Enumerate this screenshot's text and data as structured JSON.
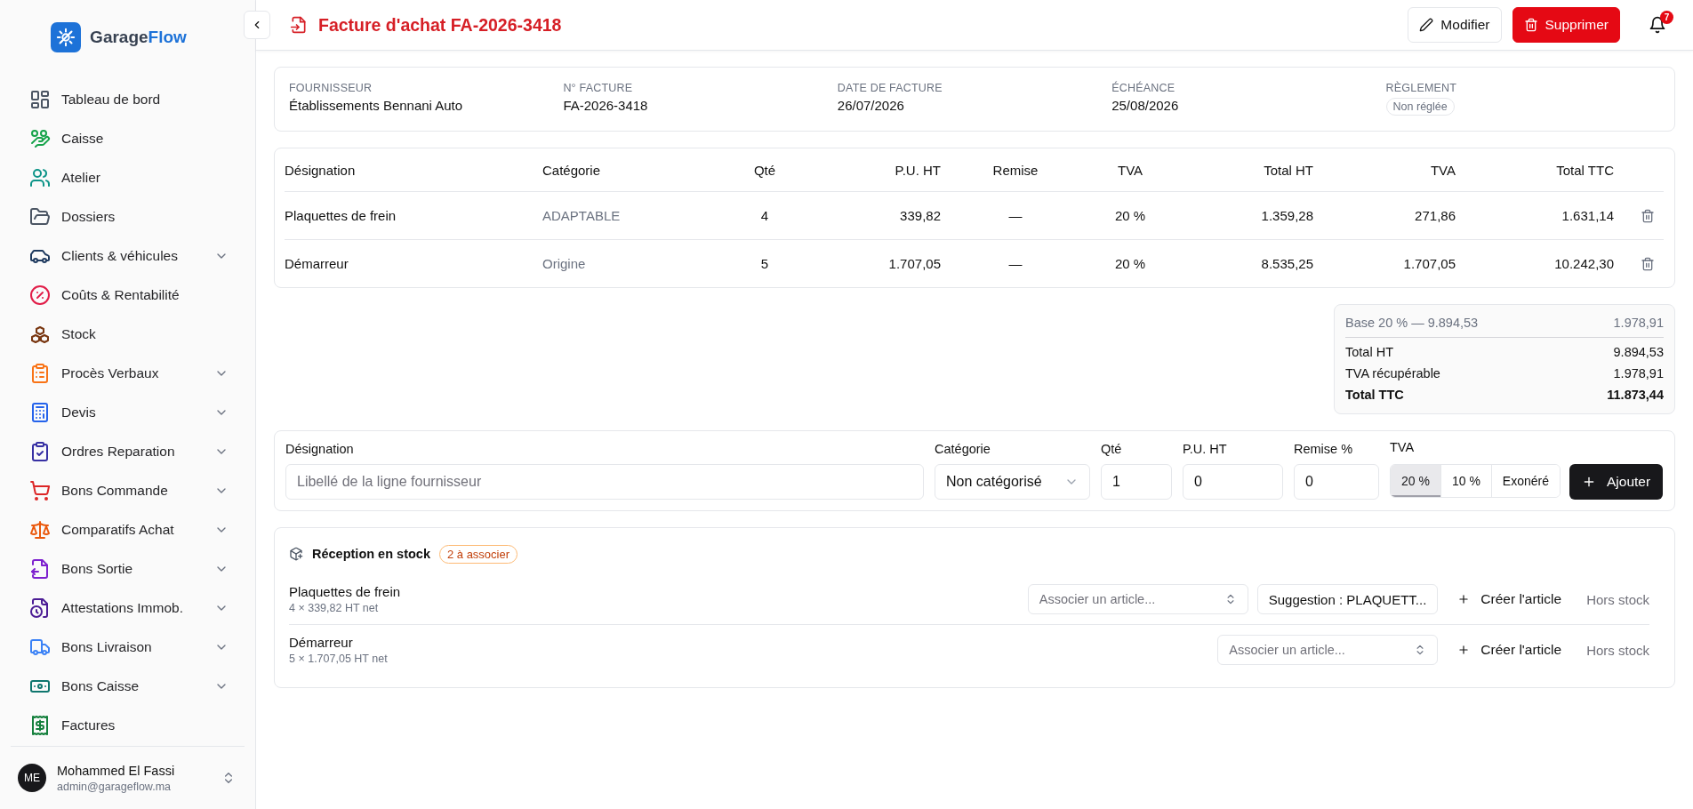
{
  "brand": {
    "text": "Garage",
    "accent": "Flow"
  },
  "sidebar": {
    "items": [
      {
        "label": "Tableau de bord",
        "color": "#4b5563",
        "expandable": false
      },
      {
        "label": "Caisse",
        "color": "#16a34a",
        "expandable": false
      },
      {
        "label": "Atelier",
        "color": "#0d9488",
        "expandable": false
      },
      {
        "label": "Dossiers",
        "color": "#4b5563",
        "expandable": false
      },
      {
        "label": "Clients & véhicules",
        "color": "#1e3a5f",
        "expandable": true
      },
      {
        "label": "Coûts & Rentabilité",
        "color": "#e11d48",
        "expandable": false
      },
      {
        "label": "Stock",
        "color": "#78350f",
        "expandable": false
      },
      {
        "label": "Procès Verbaux",
        "color": "#f97316",
        "expandable": true
      },
      {
        "label": "Devis",
        "color": "#2563eb",
        "expandable": true
      },
      {
        "label": "Ordres Reparation",
        "color": "#3730a3",
        "expandable": true
      },
      {
        "label": "Bons Commande",
        "color": "#dc2626",
        "expandable": true
      },
      {
        "label": "Comparatifs Achat",
        "color": "#ea580c",
        "expandable": true
      },
      {
        "label": "Bons Sortie",
        "color": "#7e22ce",
        "expandable": true
      },
      {
        "label": "Attestations Immob.",
        "color": "#4c1d95",
        "expandable": true
      },
      {
        "label": "Bons Livraison",
        "color": "#3b82f6",
        "expandable": true
      },
      {
        "label": "Bons Caisse",
        "color": "#0f766e",
        "expandable": true
      },
      {
        "label": "Factures",
        "color": "#15803d",
        "expandable": false
      }
    ]
  },
  "user": {
    "initials": "ME",
    "name": "Mohammed El Fassi",
    "email": "admin@garageflow.ma"
  },
  "header": {
    "title": "Facture d'achat FA-2026-3418",
    "edit_button": "Modifier",
    "delete_button": "Supprimer",
    "notifications": "7"
  },
  "info": [
    {
      "label": "FOURNISSEUR",
      "value": "Établissements Bennani Auto",
      "kind": "text"
    },
    {
      "label": "N° FACTURE",
      "value": "FA-2026-3418",
      "kind": "text"
    },
    {
      "label": "DATE DE FACTURE",
      "value": "26/07/2026",
      "kind": "text"
    },
    {
      "label": "ÉCHÉANCE",
      "value": "25/08/2026",
      "kind": "text"
    },
    {
      "label": "RÈGLEMENT",
      "value": "Non réglée",
      "kind": "badge"
    }
  ],
  "table": {
    "columns": [
      "Désignation",
      "Catégorie",
      "Qté",
      "P.U. HT",
      "Remise",
      "TVA",
      "Total HT",
      "TVA",
      "Total TTC"
    ],
    "rows": [
      {
        "cells": [
          "Plaquettes de frein",
          "ADAPTABLE",
          "4",
          "339,82",
          "—",
          "20 %",
          "1.359,28",
          "271,86",
          "1.631,14"
        ]
      },
      {
        "cells": [
          "Démarreur",
          "Origine",
          "5",
          "1.707,05",
          "—",
          "20 %",
          "8.535,25",
          "1.707,05",
          "10.242,30"
        ]
      }
    ]
  },
  "totals": {
    "base": {
      "label": "Base 20 % — 9.894,53",
      "value": "1.978,91"
    },
    "rows": [
      {
        "label": "Total HT",
        "value": "9.894,53",
        "emphasis": false
      },
      {
        "label": "TVA récupérable",
        "value": "1.978,91",
        "emphasis": false
      },
      {
        "label": "Total TTC",
        "value": "11.873,44",
        "emphasis": true
      }
    ]
  },
  "line_form": {
    "designation": {
      "label": "Désignation",
      "placeholder": "Libellé de la ligne fournisseur"
    },
    "category": {
      "label": "Catégorie",
      "value": "Non catégorisé"
    },
    "quantity": {
      "label": "Qté",
      "value": "1"
    },
    "unit_price": {
      "label": "P.U. HT",
      "value": "0"
    },
    "discount": {
      "label": "Remise %",
      "value": "0"
    },
    "vat": {
      "label": "TVA",
      "options": [
        {
          "label": "20 %",
          "selected": true
        },
        {
          "label": "10 %",
          "selected": false
        },
        {
          "label": "Exonéré",
          "selected": false
        }
      ]
    },
    "add_button": "Ajouter"
  },
  "reception": {
    "title": "Réception en stock",
    "badge": "2 à associer",
    "items": [
      {
        "name": "Plaquettes de frein",
        "detail": "4 × 339,82 HT net",
        "select_placeholder": "Associer un article...",
        "suggestion": "Suggestion : PLAQUETT...",
        "create": "Créer l'article",
        "out_of_stock": "Hors stock"
      },
      {
        "name": "Démarreur",
        "detail": "5 × 1.707,05 HT net",
        "select_placeholder": "Associer un article...",
        "create": "Créer l'article",
        "out_of_stock": "Hors stock"
      }
    ]
  }
}
